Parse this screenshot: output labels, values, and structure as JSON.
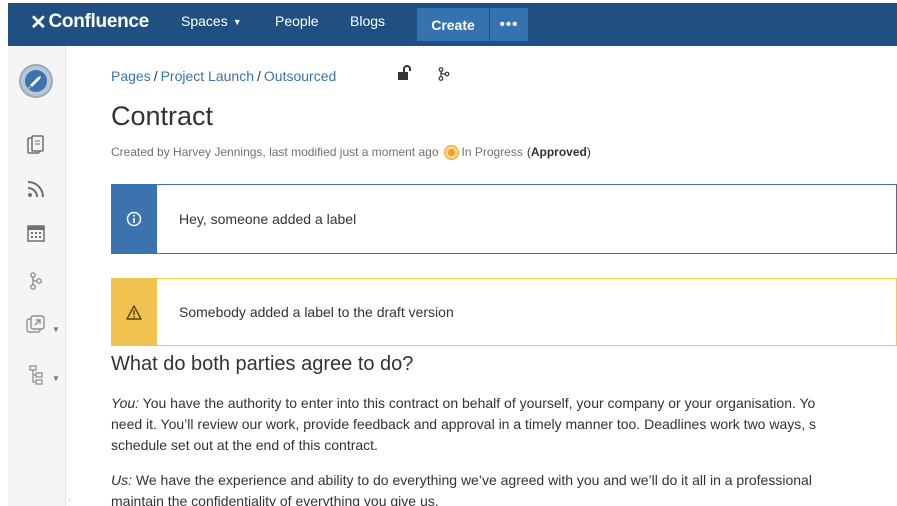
{
  "nav": {
    "logo": "Confluence",
    "spaces": "Spaces",
    "people": "People",
    "blogs": "Blogs",
    "create": "Create",
    "more": "•••"
  },
  "colors": {
    "nav_bg": "#205081",
    "create_bg": "#3572b0",
    "info": "#3b73af",
    "warning": "#f1c24f",
    "status": "#f0a21a"
  },
  "sidebar": {
    "icons": [
      "space-avatar",
      "pages-icon",
      "blog-feed-icon",
      "calendar-icon",
      "page-tree-icon",
      "shortcuts-icon",
      "hierarchy-icon"
    ]
  },
  "breadcrumb": {
    "items": [
      "Pages",
      "Project Launch",
      "Outsourced"
    ],
    "separator": "/"
  },
  "page": {
    "title": "Contract",
    "byline": "Created by Harvey Jennings, last modified just a moment ago",
    "status": "In Progress",
    "approved": "Approved"
  },
  "panels": {
    "info_text": "Hey, someone added a label",
    "warning_text": "Somebody added a label to the draft version"
  },
  "content": {
    "heading": "What do both parties agree to do?",
    "p1_label": "You:",
    "p1_line1": " You have the authority to enter into this contract on behalf of yourself, your company or your organisation. Yo",
    "p1_line2": "need it. You’ll review our work, provide feedback and approval in a timely manner too. Deadlines work two ways, s",
    "p1_line3": "schedule set out at the end of this contract.",
    "p2_label": "Us:",
    "p2_line1": " We have the experience and ability to do everything we’ve agreed with you and we’ll do it all in a professional",
    "p2_line2": "maintain the confidentiality of everything you give us."
  }
}
